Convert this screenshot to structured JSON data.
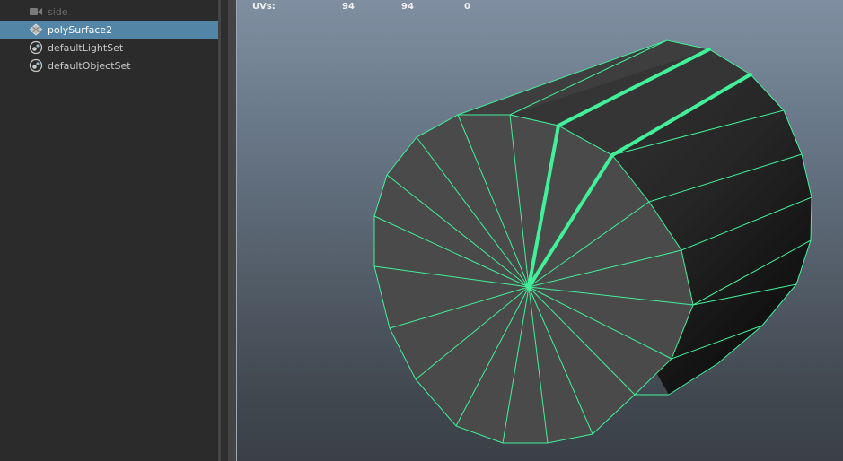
{
  "outliner": {
    "items": [
      {
        "label": "side",
        "icon": "camera-icon",
        "state": "dim"
      },
      {
        "label": "polySurface2",
        "icon": "mesh-icon",
        "state": "selected"
      },
      {
        "label": "defaultLightSet",
        "icon": "set-icon",
        "state": "normal"
      },
      {
        "label": "defaultObjectSet",
        "icon": "set-icon",
        "state": "normal"
      }
    ]
  },
  "viewport": {
    "hud": {
      "label": "UVs:",
      "col1": "94",
      "col2": "94",
      "col3": "0"
    },
    "colors": {
      "wire": "#42f09a",
      "face": "#4a4a4a",
      "selection_bg": "#5285a6"
    }
  }
}
